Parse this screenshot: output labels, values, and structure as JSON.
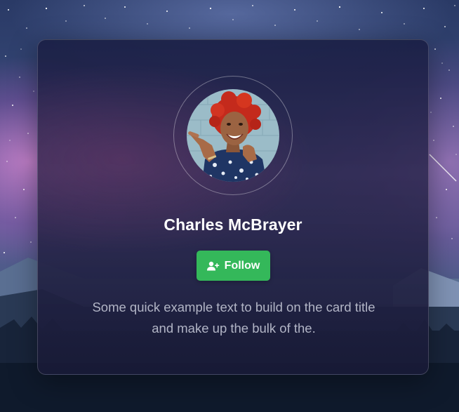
{
  "card": {
    "name": "Charles McBrayer",
    "follow_label": "Follow",
    "follow_icon": "user-plus-icon",
    "description": "Some quick example text to build on the card title and make up the bulk of the.",
    "accent_color": "#34b85a"
  },
  "background": {
    "scene": "starry-night-sky-over-mountains"
  }
}
